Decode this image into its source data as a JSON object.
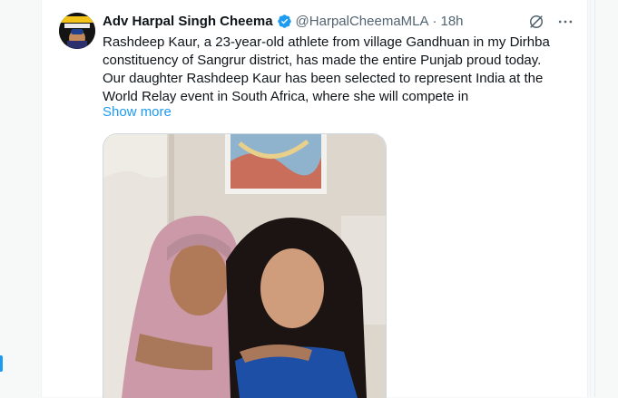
{
  "tweet": {
    "display_name": "Adv Harpal Singh Cheema",
    "handle": "@HarpalCheemaMLA",
    "separator": "·",
    "time": "18h",
    "text_lines": [
      "Rashdeep Kaur, a 23-year-old athlete from village Gandhuan in my Dirhba",
      "constituency of Sangrur district, has made the entire Punjab proud today.",
      "Our daughter Rashdeep Kaur has been selected to represent India at the",
      "World Relay event in South Africa, where she will compete in"
    ],
    "show_more": "Show more"
  },
  "icons": {
    "verified": "verified-badge-icon",
    "grok": "grok-icon",
    "more": "more-options-icon"
  },
  "colors": {
    "accent": "#1d9bf0",
    "text": "#0f1419",
    "muted": "#536471",
    "border": "#cfd9de",
    "page_bg": "#f7f9f9"
  }
}
